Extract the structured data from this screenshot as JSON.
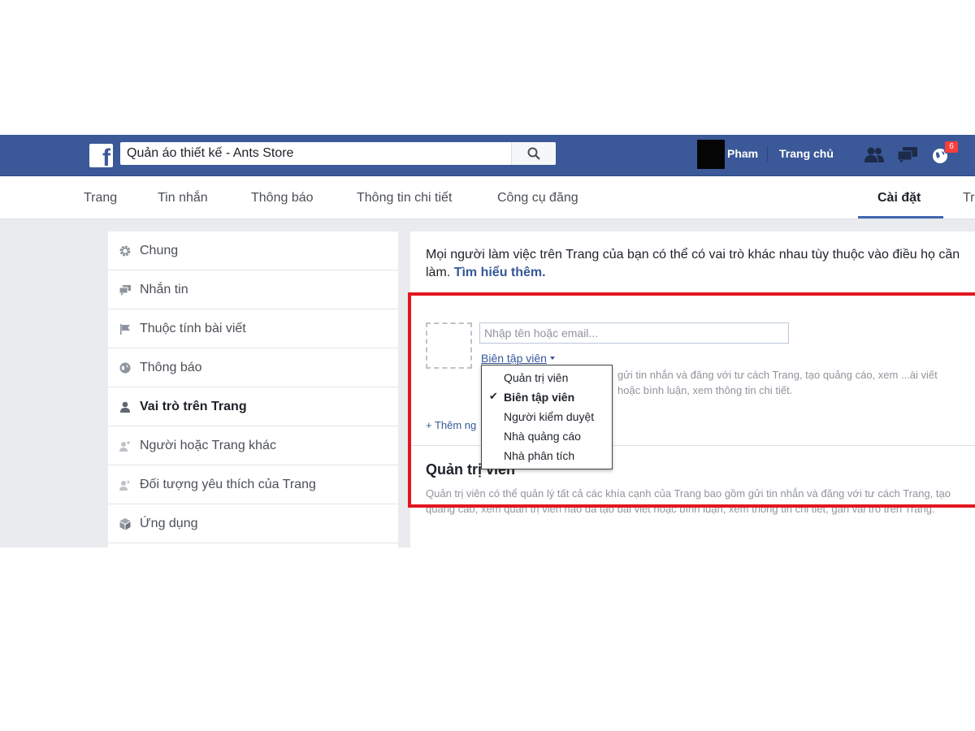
{
  "header": {
    "search_value": "Quản áo thiết kế - Ants Store",
    "user_name": "Pham",
    "home_label": "Trang chủ",
    "notification_count": "6"
  },
  "tabs": [
    {
      "label": "Trang"
    },
    {
      "label": "Tin nhắn"
    },
    {
      "label": "Thông báo"
    },
    {
      "label": "Thông tin chi tiết"
    },
    {
      "label": "Công cụ đăng"
    },
    {
      "label": "Cài đặt",
      "active": true
    },
    {
      "label": "Tr"
    }
  ],
  "sidebar": {
    "items": [
      {
        "label": "Chung",
        "icon": "gear-icon"
      },
      {
        "label": "Nhắn tin",
        "icon": "chat-bubbles-icon"
      },
      {
        "label": "Thuộc tính bài viết",
        "icon": "flag-icon"
      },
      {
        "label": "Thông báo",
        "icon": "globe-icon"
      },
      {
        "label": "Vai trò trên Trang",
        "icon": "person-icon",
        "active": true
      },
      {
        "label": "Người hoặc Trang khác",
        "icon": "person-add-icon"
      },
      {
        "label": "Đối tượng yêu thích của Trang",
        "icon": "person-star-icon"
      },
      {
        "label": "Ứng dụng",
        "icon": "cube-icon"
      }
    ]
  },
  "main": {
    "intro_text": "Mọi người làm việc trên Trang của bạn có thể có vai trò khác nhau tùy thuộc vào điều họ cần làm.",
    "learn_more": "Tìm hiểu thêm.",
    "name_input_placeholder": "Nhập tên hoặc email...",
    "selected_role": "Biên tập viên",
    "role_description": "gửi tin nhắn và đăng với tư cách Trang, tạo quảng cáo, xem ...ài viết hoặc bình luận, xem thông tin chi tiết.",
    "add_more": "+ Thêm ng",
    "admin_section_title": "Quản trị viên",
    "admin_section_desc": "Quản trị viên có thể quản lý tất cả các khía cạnh của Trang bao gồm gửi tin nhắn và đăng với tư cách Trang, tạo quảng cáo, xem quản trị viên nào đã tạo bài viết hoặc bình luận, xem thông tin chi tiết, gán vai trò trên Trang."
  },
  "role_dropdown": {
    "options": [
      "Quản trị viên",
      "Biên tập viên",
      "Người kiểm duyệt",
      "Nhà quảng cáo",
      "Nhà phân tích"
    ],
    "selected_index": 1
  },
  "colors": {
    "brand_blue": "#3b5998",
    "link_blue": "#365899",
    "highlight_red": "#e3161e",
    "badge_red": "#fa3e3e"
  }
}
